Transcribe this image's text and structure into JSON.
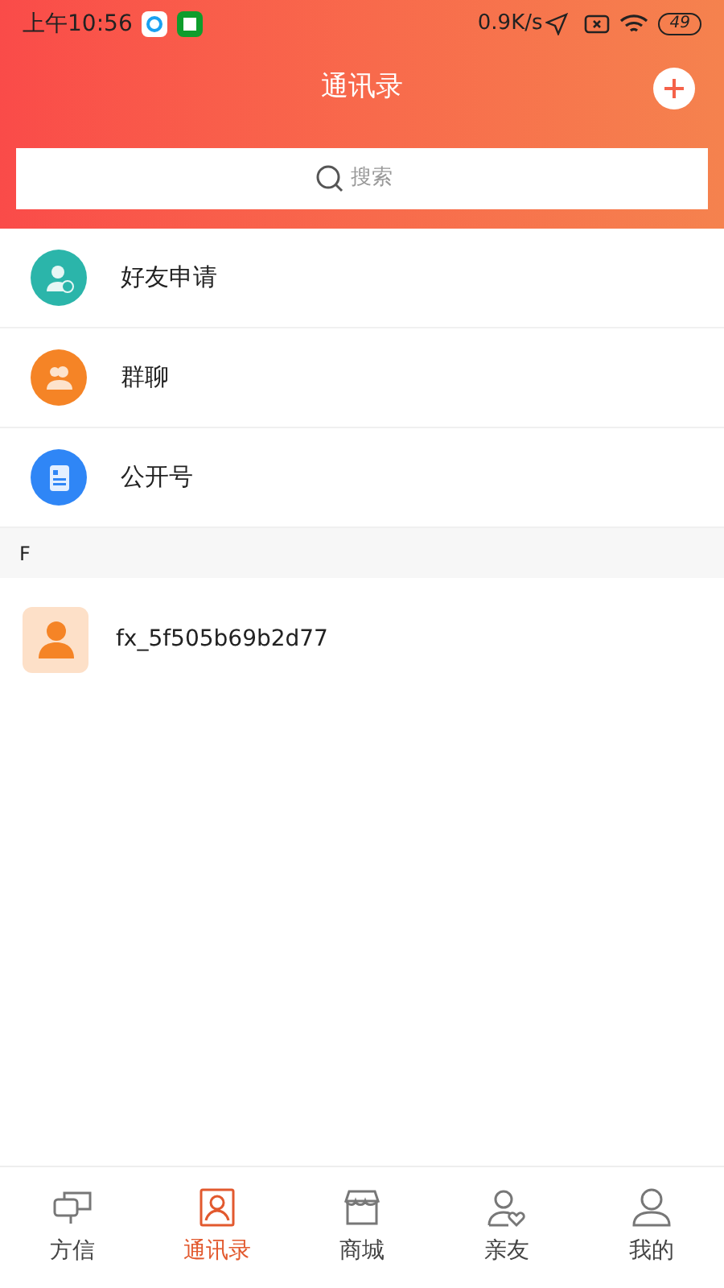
{
  "status_bar": {
    "time": "上午10:56",
    "speed": "0.9K/s",
    "battery": "49"
  },
  "header": {
    "title": "通讯录"
  },
  "search": {
    "placeholder": "搜索"
  },
  "menu": [
    {
      "kind": "friend-request",
      "label": "好友申请"
    },
    {
      "kind": "group-chat",
      "label": "群聊"
    },
    {
      "kind": "public-account",
      "label": "公开号"
    }
  ],
  "sections": [
    {
      "letter": "F",
      "contacts": [
        {
          "name": "fx_5f505b69b2d77"
        }
      ]
    }
  ],
  "tab_bar": [
    {
      "kind": "messages",
      "label": "方信",
      "selected": false
    },
    {
      "kind": "contacts",
      "label": "通讯录",
      "selected": true
    },
    {
      "kind": "shop",
      "label": "商城",
      "selected": false
    },
    {
      "kind": "family",
      "label": "亲友",
      "selected": false
    },
    {
      "kind": "me",
      "label": "我的",
      "selected": false
    }
  ]
}
